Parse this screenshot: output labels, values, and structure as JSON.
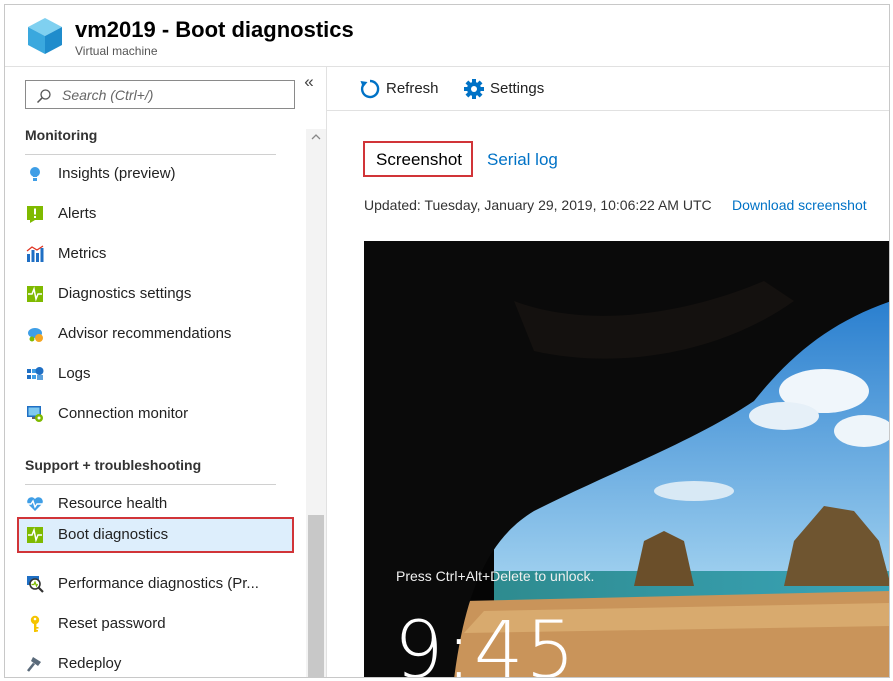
{
  "header": {
    "title": "vm2019 - Boot diagnostics",
    "subtitle": "Virtual machine",
    "icon": "virtual-machine-cube-icon"
  },
  "sidebar": {
    "search": {
      "placeholder": "Search (Ctrl+/)",
      "value": ""
    },
    "collapse_glyph": "«",
    "sections": [
      {
        "title": "Monitoring",
        "items": [
          {
            "label": "Insights (preview)",
            "icon": "lightbulb-icon"
          },
          {
            "label": "Alerts",
            "icon": "alert-icon"
          },
          {
            "label": "Metrics",
            "icon": "bar-chart-icon"
          },
          {
            "label": "Diagnostics settings",
            "icon": "pulse-icon"
          },
          {
            "label": "Advisor recommendations",
            "icon": "cloud-advisor-icon"
          },
          {
            "label": "Logs",
            "icon": "logs-icon"
          },
          {
            "label": "Connection monitor",
            "icon": "connection-monitor-icon"
          }
        ]
      },
      {
        "title": "Support + troubleshooting",
        "items": [
          {
            "label": "Resource health",
            "icon": "heart-pulse-icon"
          },
          {
            "label": "Boot diagnostics",
            "icon": "pulse-icon",
            "selected": true
          },
          {
            "label": "Performance diagnostics (Pr...",
            "icon": "magnifier-icon"
          },
          {
            "label": "Reset password",
            "icon": "key-icon"
          },
          {
            "label": "Redeploy",
            "icon": "hammer-icon"
          }
        ]
      }
    ]
  },
  "toolbar": {
    "refresh_label": "Refresh",
    "settings_label": "Settings"
  },
  "tabs": [
    {
      "label": "Screenshot",
      "active": true
    },
    {
      "label": "Serial log",
      "active": false
    }
  ],
  "updated_text": "Updated: Tuesday, January 29, 2019, 10:06:22 AM UTC",
  "download_label": "Download screenshot",
  "screenshot": {
    "lock_message": "Press Ctrl+Alt+Delete to unlock.",
    "time": "9:45"
  },
  "colors": {
    "accent_blue": "#0072c6",
    "highlight_red": "#d13438",
    "selected_bg": "#ddeefc"
  }
}
